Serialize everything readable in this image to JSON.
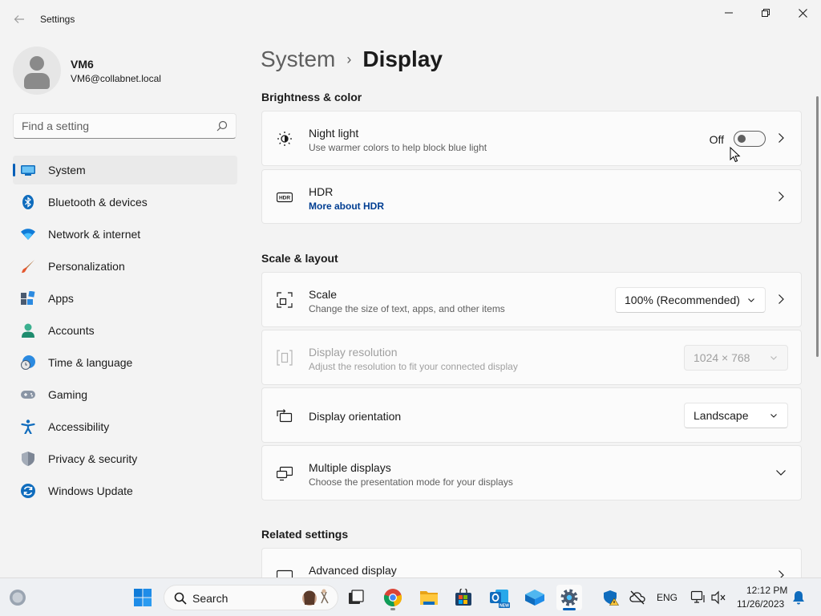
{
  "window": {
    "title": "Settings",
    "back_icon": "arrow-left-icon",
    "minimize_icon": "minimize-icon",
    "maximize_icon": "restore-icon",
    "close_icon": "close-icon"
  },
  "profile": {
    "name": "VM6",
    "email": "VM6@collabnet.local",
    "avatar_icon": "user-avatar-icon"
  },
  "search": {
    "placeholder": "Find a setting",
    "icon": "search-icon"
  },
  "sidebar": {
    "items": [
      {
        "label": "System",
        "icon": "display-icon",
        "active": true
      },
      {
        "label": "Bluetooth & devices",
        "icon": "bluetooth-icon"
      },
      {
        "label": "Network & internet",
        "icon": "wifi-icon"
      },
      {
        "label": "Personalization",
        "icon": "brush-icon"
      },
      {
        "label": "Apps",
        "icon": "apps-icon"
      },
      {
        "label": "Accounts",
        "icon": "person-icon"
      },
      {
        "label": "Time & language",
        "icon": "globe-clock-icon"
      },
      {
        "label": "Gaming",
        "icon": "gamepad-icon"
      },
      {
        "label": "Accessibility",
        "icon": "accessibility-icon"
      },
      {
        "label": "Privacy & security",
        "icon": "shield-icon"
      },
      {
        "label": "Windows Update",
        "icon": "update-icon"
      }
    ]
  },
  "breadcrumb": {
    "parent": "System",
    "separator": "›",
    "current": "Display"
  },
  "sections": {
    "brightness": "Brightness & color",
    "scale_layout": "Scale & layout",
    "related": "Related settings"
  },
  "cards": {
    "night_light": {
      "title": "Night light",
      "subtitle": "Use warmer colors to help block blue light",
      "state_label": "Off",
      "enabled": false,
      "icon": "brightness-icon"
    },
    "hdr": {
      "title": "HDR",
      "link": "More about HDR",
      "icon": "hdr-icon"
    },
    "scale": {
      "title": "Scale",
      "subtitle": "Change the size of text, apps, and other items",
      "value": "100% (Recommended)",
      "icon": "scale-icon"
    },
    "resolution": {
      "title": "Display resolution",
      "subtitle": "Adjust the resolution to fit your connected display",
      "value": "1024 × 768",
      "disabled": true,
      "icon": "resolution-icon"
    },
    "orientation": {
      "title": "Display orientation",
      "value": "Landscape",
      "icon": "orientation-icon"
    },
    "multiple": {
      "title": "Multiple displays",
      "subtitle": "Choose the presentation mode for your displays",
      "icon": "multiple-displays-icon"
    },
    "advanced": {
      "title": "Advanced display",
      "icon": "monitor-icon"
    }
  },
  "taskbar": {
    "search_label": "Search",
    "language": "ENG",
    "time": "12:12 PM",
    "date": "11/26/2023",
    "apps": [
      "start-icon",
      "task-view-icon",
      "chrome-icon",
      "file-explorer-icon",
      "store-icon",
      "outlook-icon",
      "azure-icon",
      "settings-icon"
    ],
    "accent": "#005fb8"
  }
}
